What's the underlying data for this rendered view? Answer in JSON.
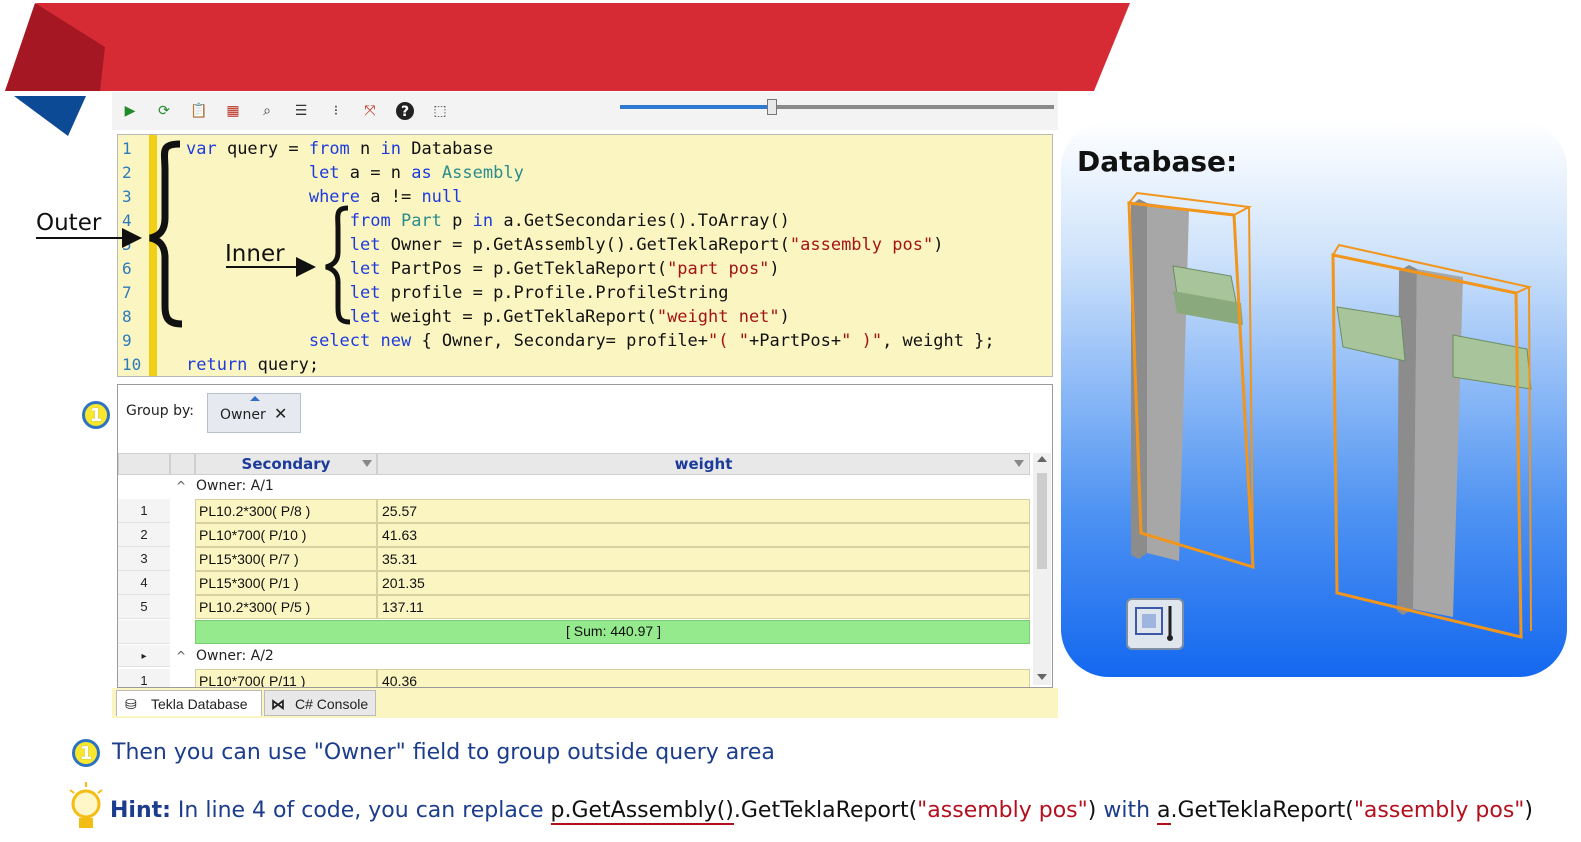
{
  "toolbar": {
    "icons": [
      "run-icon",
      "refresh-icon",
      "clipboard-icon",
      "table-icon",
      "search-icon",
      "list-icon",
      "filter-icon",
      "cursor-icon",
      "help-icon",
      "screenshot-icon"
    ],
    "slider_value": 0.35
  },
  "editor": {
    "line_numbers": [
      "1",
      "2",
      "3",
      "4",
      "5",
      "6",
      "7",
      "8",
      "9",
      "10"
    ],
    "lines": [
      [
        [
          "kw",
          "var"
        ],
        [
          "",
          "&nbsp;query = "
        ],
        [
          "kw",
          "from"
        ],
        [
          "",
          " n "
        ],
        [
          "kw",
          "in"
        ],
        [
          "",
          " Database"
        ]
      ],
      [
        [
          "",
          "            "
        ],
        [
          "kw",
          "let"
        ],
        [
          "",
          " a = n "
        ],
        [
          "kw",
          "as"
        ],
        [
          "",
          ""
        ],
        [
          "ty",
          " Assembly"
        ]
      ],
      [
        [
          "",
          "            "
        ],
        [
          "kw",
          "where"
        ],
        [
          "",
          " a != "
        ],
        [
          "kw",
          "null"
        ]
      ],
      [
        [
          "",
          "                "
        ],
        [
          "kw",
          "from"
        ],
        [
          "ty",
          " Part"
        ],
        [
          "",
          " p "
        ],
        [
          "kw",
          "in"
        ],
        [
          "",
          " a.GetSecondaries().ToArray()"
        ]
      ],
      [
        [
          "",
          "                "
        ],
        [
          "kw",
          "let"
        ],
        [
          "",
          " Owner = p.GetAssembly().GetTeklaReport("
        ],
        [
          "st",
          "\"assembly pos\""
        ],
        [
          "",
          ")"
        ]
      ],
      [
        [
          "",
          "                "
        ],
        [
          "kw",
          "let"
        ],
        [
          "",
          " PartPos = p.GetTeklaReport("
        ],
        [
          "st",
          "\"part pos\""
        ],
        [
          "",
          ")"
        ]
      ],
      [
        [
          "",
          "                "
        ],
        [
          "kw",
          "let"
        ],
        [
          "",
          " profile = p.Profile.ProfileString"
        ]
      ],
      [
        [
          "",
          "                "
        ],
        [
          "kw",
          "let"
        ],
        [
          "",
          " weight = p.GetTeklaReport("
        ],
        [
          "st",
          "\"weight net\""
        ],
        [
          "",
          ")"
        ]
      ],
      [
        [
          "",
          "            "
        ],
        [
          "kw",
          "select"
        ],
        [
          "",
          " "
        ],
        [
          "kw",
          "new"
        ],
        [
          "",
          " { Owner, Secondary= profile+"
        ],
        [
          "st",
          "\"( \""
        ],
        [
          "",
          "+PartPos+"
        ],
        [
          "st",
          "\" )\""
        ],
        [
          "",
          ", weight };"
        ]
      ],
      [
        [
          "kw",
          "return"
        ],
        [
          "",
          " query;"
        ]
      ]
    ]
  },
  "annotations": {
    "outer": "Outer",
    "inner": "Inner",
    "badge": "1"
  },
  "grid": {
    "group_by_label": "Group by:",
    "group_chip": "Owner",
    "group_chip_close": "✕",
    "columns": [
      "Secondary",
      "weight"
    ],
    "groups": [
      {
        "label": "Owner: A/1",
        "rows": [
          {
            "n": "1",
            "secondary": "PL10.2*300( P/8 )",
            "weight": "25.57"
          },
          {
            "n": "2",
            "secondary": "PL10*700( P/10 )",
            "weight": "41.63"
          },
          {
            "n": "3",
            "secondary": "PL15*300( P/7 )",
            "weight": "35.31"
          },
          {
            "n": "4",
            "secondary": "PL15*300( P/1 )",
            "weight": "201.35"
          },
          {
            "n": "5",
            "secondary": "PL10.2*300( P/5 )",
            "weight": "137.11"
          }
        ],
        "sum": "[ Sum: 440.97 ]"
      },
      {
        "label": "Owner: A/2",
        "rows": [
          {
            "n": "1",
            "secondary": "PL10*700( P/11 )",
            "weight": "40.36"
          }
        ]
      }
    ]
  },
  "tabs": {
    "tekla_database": "Tekla Database",
    "csharp_console": "C# Console"
  },
  "database_panel": {
    "title": "Database:"
  },
  "bottom": {
    "step_text": "Then you can use \"Owner\" field to group outside query area",
    "hint_label": "Hint:",
    "hint_text_1": " In line 4 of code, you can replace ",
    "hint_code_1a": "p.GetAssembly()",
    "hint_code_1b": ".GetTeklaReport(",
    "hint_str": "\"assembly pos\"",
    "hint_close": ")",
    "hint_with": " with ",
    "hint_code_2a": "a",
    "hint_code_2b": ".GetTeklaReport(",
    "hint_close2": ")"
  },
  "colors": {
    "banner_red": "#d62b34",
    "banner_blue": "#0d4a96",
    "editor_bg": "#fbf5c2",
    "sum_green": "#94ea8c",
    "keyword": "#1e3cdc"
  }
}
